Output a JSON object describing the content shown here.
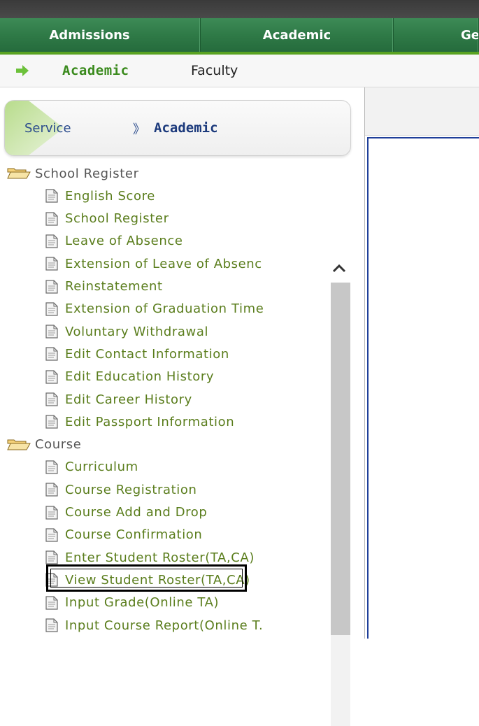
{
  "nav": {
    "tabs": [
      {
        "label": "Admissions"
      },
      {
        "label": "Academic"
      },
      {
        "label": "Ge"
      }
    ],
    "colors": {
      "bar": "#2f7a47",
      "underline": "#5aa322"
    }
  },
  "breadcrumb": {
    "icon": "green-arrow-icon",
    "current": "Academic",
    "sub": "Faculty"
  },
  "service": {
    "label": "Service",
    "separator": "》",
    "current": "Academic"
  },
  "tree": {
    "folders": [
      {
        "label": "School Register",
        "items": [
          "English Score",
          "School Register",
          "Leave of Absence",
          "Extension of Leave of Absenc",
          "Reinstatement",
          "Extension of Graduation Time",
          "Voluntary Withdrawal",
          "Edit Contact Information",
          "Edit Education History",
          "Edit Career History",
          "Edit Passport Information"
        ]
      },
      {
        "label": "Course",
        "items": [
          "Curriculum",
          "Course Registration",
          "Course Add and Drop",
          "Course Confirmation",
          "Enter Student Roster(TA,CA)",
          "View Student Roster(TA,CA)",
          "Input Grade(Online TA)",
          "Input Course Report(Online T."
        ]
      }
    ],
    "highlighted_item": "Course Registration"
  }
}
